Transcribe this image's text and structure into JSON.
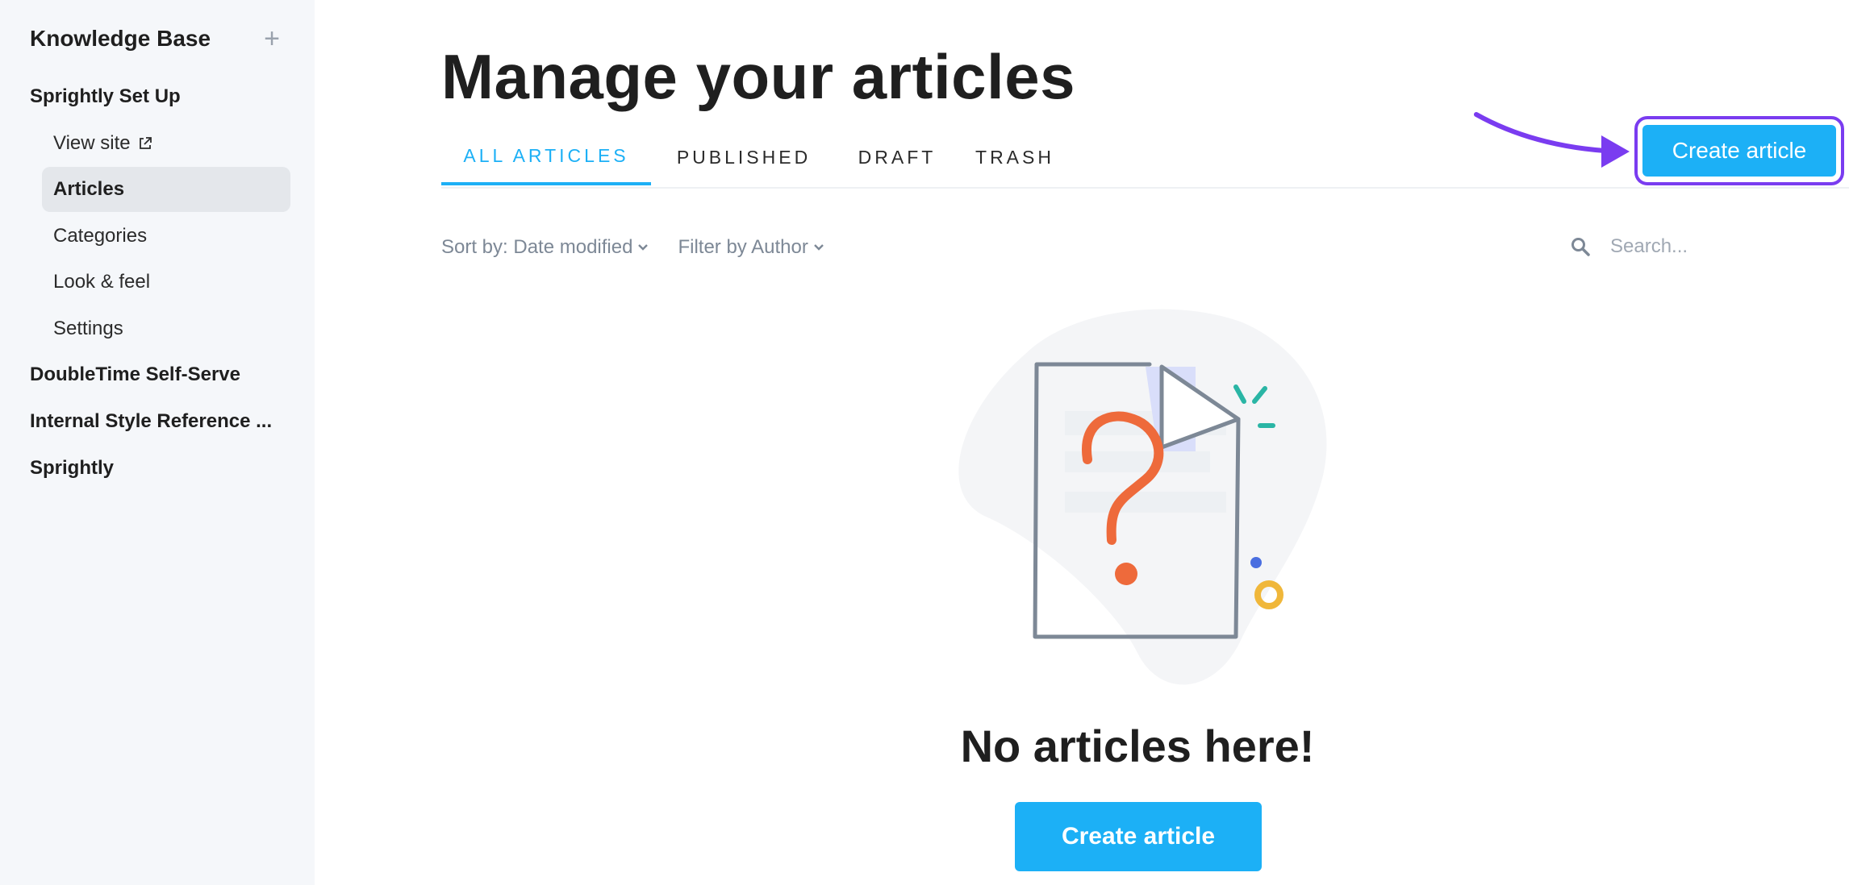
{
  "sidebar": {
    "title": "Knowledge Base",
    "add_icon": "plus-icon",
    "items": [
      {
        "label": "Sprightly Set Up"
      },
      {
        "label": "View site",
        "icon": "external-link-icon"
      },
      {
        "label": "Articles",
        "active": true
      },
      {
        "label": "Categories"
      },
      {
        "label": "Look & feel"
      },
      {
        "label": "Settings"
      },
      {
        "label": "DoubleTime Self-Serve"
      },
      {
        "label": "Internal Style Reference ..."
      },
      {
        "label": "Sprightly"
      }
    ]
  },
  "main": {
    "title": "Manage your articles",
    "tabs": [
      {
        "label": "ALL ARTICLES",
        "active": true
      },
      {
        "label": "PUBLISHED"
      },
      {
        "label": "DRAFT"
      },
      {
        "label": "TRASH"
      }
    ],
    "create_button_label": "Create article",
    "sort_label": "Sort by: Date modified",
    "filter_label": "Filter by Author",
    "search": {
      "placeholder": "Search...",
      "icon": "search-icon"
    },
    "empty_state": {
      "illustration": "document-question-mark-illustration",
      "title": "No articles here!",
      "button_label": "Create article"
    }
  },
  "annotation": {
    "arrow_color": "#7a3cf0",
    "highlight": "create-article-button"
  },
  "colors": {
    "accent": "#1cb0f6",
    "sidebar_bg": "#f5f7fa",
    "active_item_bg": "#e4e7eb",
    "text_muted": "#7d8896"
  }
}
